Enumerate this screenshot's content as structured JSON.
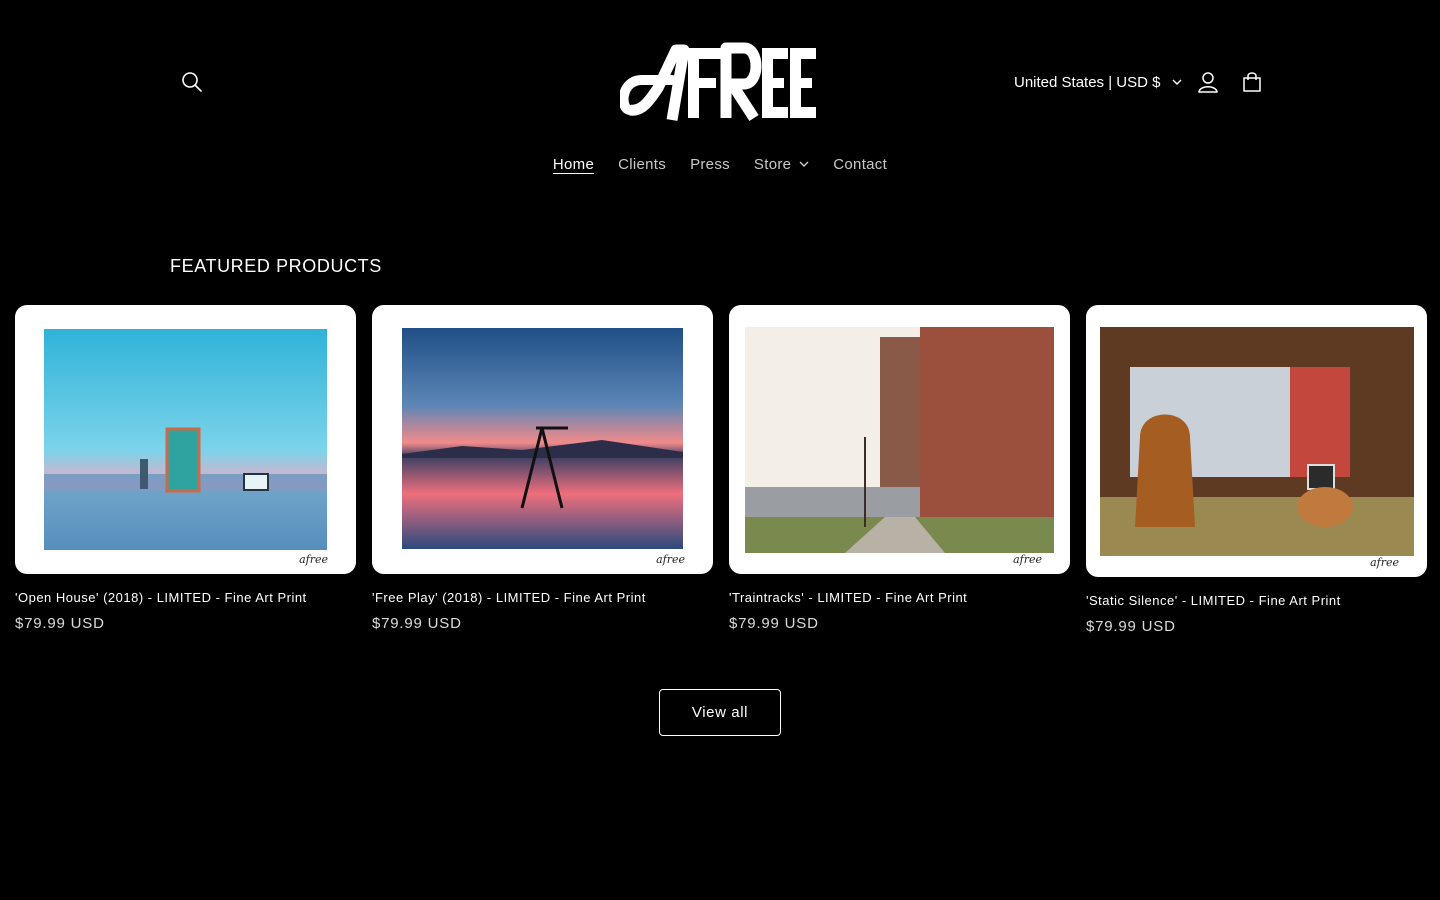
{
  "header": {
    "logo_text": "AFREE",
    "country_selector": "United States | USD $",
    "icons": {
      "search": "search-icon",
      "account": "user-icon",
      "cart": "bag-icon",
      "dropdown": "chevron-down-icon"
    }
  },
  "nav": {
    "items": [
      {
        "label": "Home",
        "active": true
      },
      {
        "label": "Clients"
      },
      {
        "label": "Press"
      },
      {
        "label": "Store",
        "has_dropdown": true
      },
      {
        "label": "Contact"
      }
    ]
  },
  "featured": {
    "heading": "FEATURED PRODUCTS",
    "products": [
      {
        "title": "'Open House' (2018) - LIMITED - Fine Art Print",
        "price": "$79.99 USD"
      },
      {
        "title": "'Free Play' (2018) - LIMITED - Fine Art Print",
        "price": "$79.99 USD"
      },
      {
        "title": "'Traintracks' - LIMITED - Fine Art Print",
        "price": "$79.99 USD"
      },
      {
        "title": "'Static Silence' - LIMITED - Fine Art Print",
        "price": "$79.99 USD"
      }
    ],
    "view_all_label": "View all"
  },
  "colors": {
    "background": "#000000",
    "text": "#ffffff"
  }
}
